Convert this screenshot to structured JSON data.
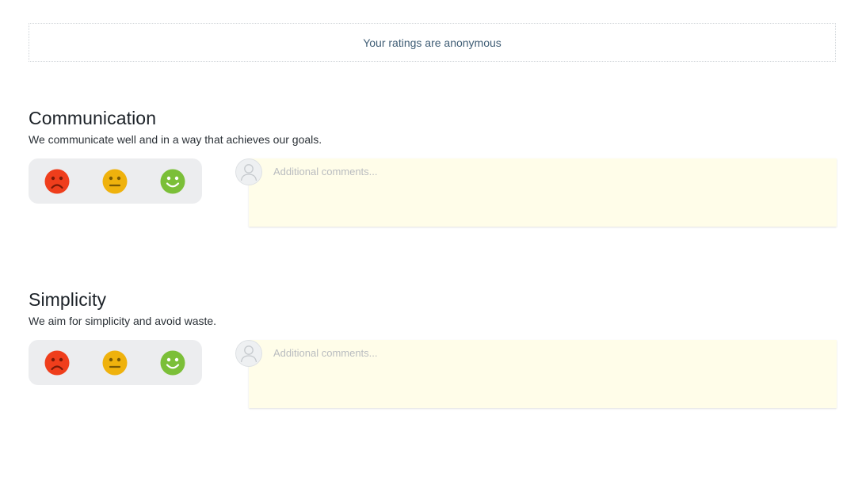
{
  "notice": {
    "text": "Your ratings are anonymous"
  },
  "sections": [
    {
      "title": "Communication",
      "description": "We communicate well and in a way that achieves our goals.",
      "comment_placeholder": "Additional comments...",
      "comment_value": ""
    },
    {
      "title": "Simplicity",
      "description": "We aim for simplicity and avoid waste.",
      "comment_placeholder": "Additional comments...",
      "comment_value": ""
    }
  ],
  "icons": {
    "sad": "sad-face-icon",
    "neutral": "neutral-face-icon",
    "happy": "happy-face-icon",
    "avatar": "user-avatar-icon"
  },
  "colors": {
    "sad": "#ef3e1c",
    "neutral": "#efb20d",
    "happy": "#7bbf38",
    "notice_text": "#3f5d75",
    "comment_bg": "#fffde9",
    "rating_bg": "#ecedef"
  }
}
